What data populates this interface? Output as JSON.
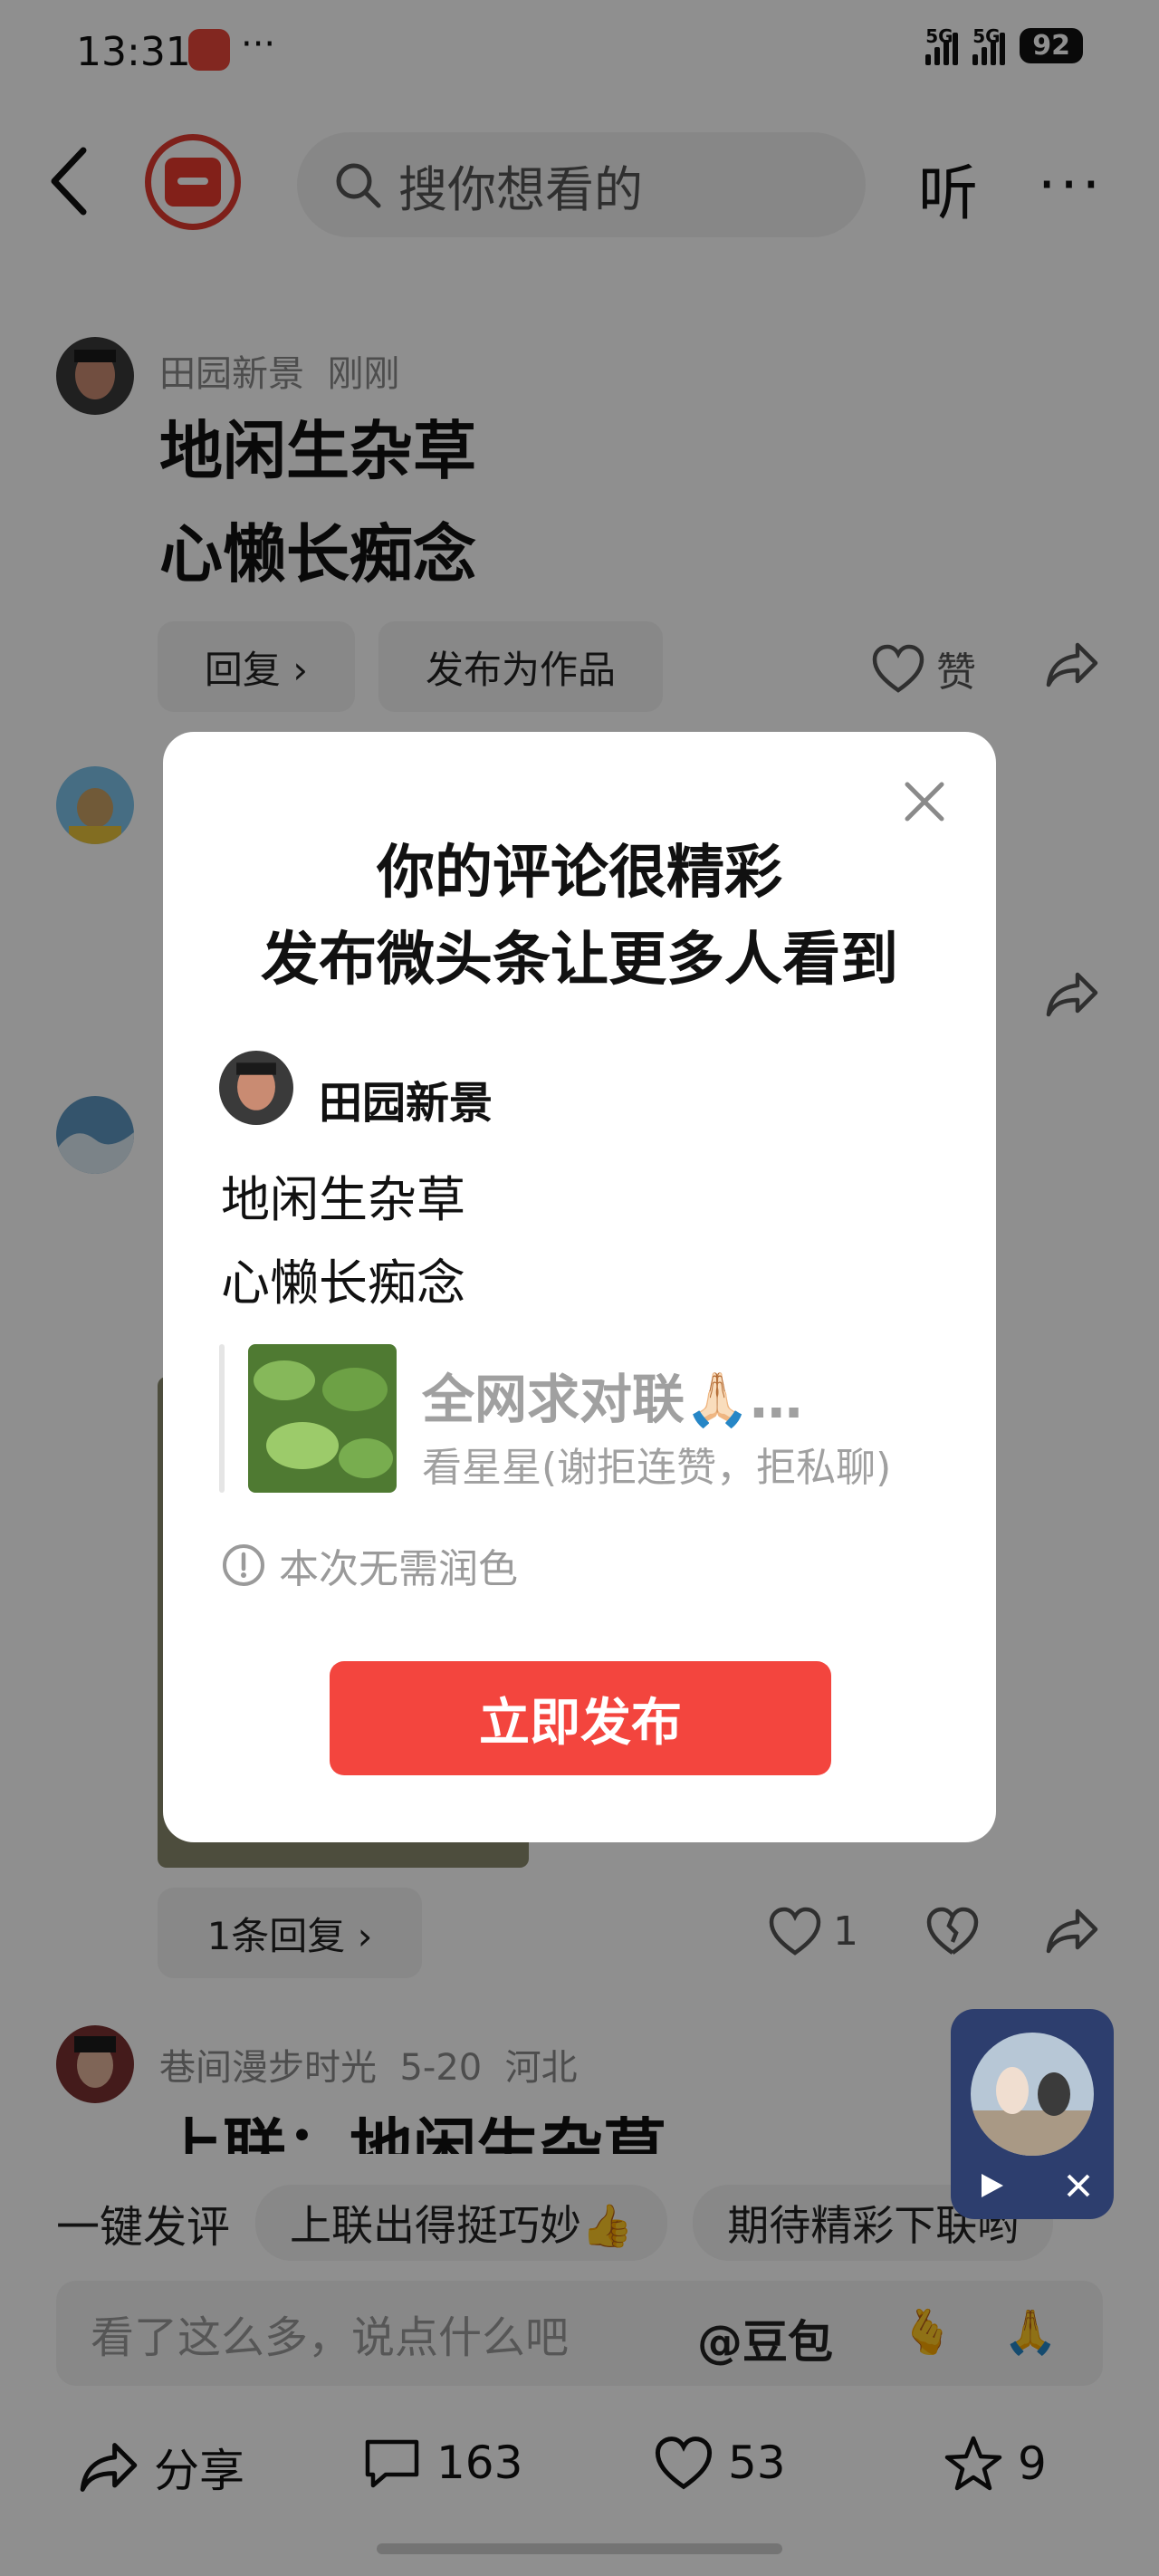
{
  "status_bar": {
    "time": "13:31",
    "dots": "···",
    "net1": "5G",
    "net2": "5G",
    "battery": "92"
  },
  "header": {
    "search_placeholder": "搜你想看的",
    "listen": "听",
    "more": "···"
  },
  "comments": [
    {
      "author": "田园新景",
      "time": "刚刚",
      "line1": "地闲生杂草",
      "line2": "心懒长痴念",
      "reply_label": "回复 ›",
      "publish_as_work": "发布为作品",
      "like_label": "赞"
    },
    {
      "reply_count_label": "1条回复 ›",
      "like_count": "1"
    },
    {
      "author": "巷间漫步时光",
      "time": "5-20",
      "location": "河北",
      "text_partial": "上联：地闲生杂草"
    }
  ],
  "quick_replies": [
    "一键发评",
    "上联出得挺巧妙👍",
    "期待精彩下联哟"
  ],
  "input": {
    "placeholder": "看了这么多，说点什么吧",
    "doubao": "@豆包"
  },
  "toolbar": {
    "share": "分享",
    "comments": "163",
    "likes": "53",
    "favorites": "9"
  },
  "modal": {
    "title_line1": "你的评论很精彩",
    "title_line2": "发布微头条让更多人看到",
    "author": "田园新景",
    "line1": "地闲生杂草",
    "line2": "心懒长痴念",
    "quote_title": "全网求对联🙏🏻…",
    "quote_sub": "看星星(谢拒连赞，拒私聊)",
    "hint": "本次无需润色",
    "publish_button": "立即发布"
  },
  "colors": {
    "accent": "#f3453e",
    "brand_red": "#e03a2f",
    "overlay": "rgba(0,0,0,0.44)"
  },
  "icons": [
    "back-icon",
    "search-icon",
    "heart-icon",
    "share-icon",
    "broken-heart-icon",
    "comment-icon",
    "star-icon",
    "close-icon",
    "info-icon",
    "play-icon"
  ]
}
